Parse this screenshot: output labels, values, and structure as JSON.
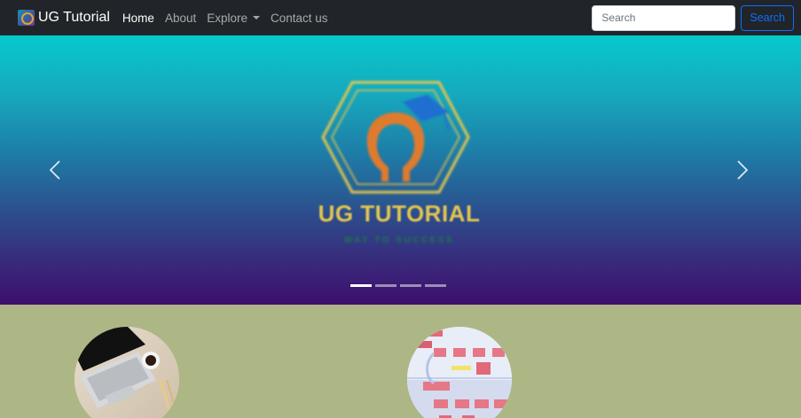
{
  "navbar": {
    "brand": "UG Tutorial",
    "links": [
      {
        "label": "Home",
        "active": true
      },
      {
        "label": "About",
        "active": false
      },
      {
        "label": "Explore",
        "active": false,
        "dropdown": true
      },
      {
        "label": "Contact us",
        "active": false
      }
    ],
    "search": {
      "placeholder": "Search",
      "button_label": "Search"
    }
  },
  "carousel": {
    "slide_title": "UG TUTORIAL",
    "slide_tagline": "WAY TO SUCCESS",
    "slide_count": 4,
    "active_slide": 1,
    "colors": {
      "top": "#06c9cc",
      "bottom": "#3d0f6d",
      "logo_gold": "#e3c54f",
      "logo_orange": "#e07b2e",
      "cap_blue": "#1f6fd1"
    }
  },
  "colors": {
    "navbar_bg": "#212529",
    "content_bg": "#adb785",
    "accent": "#0d6efd"
  },
  "icons": [
    "brand-logo-icon",
    "chevron-down-icon",
    "chevron-left-icon",
    "chevron-right-icon"
  ]
}
